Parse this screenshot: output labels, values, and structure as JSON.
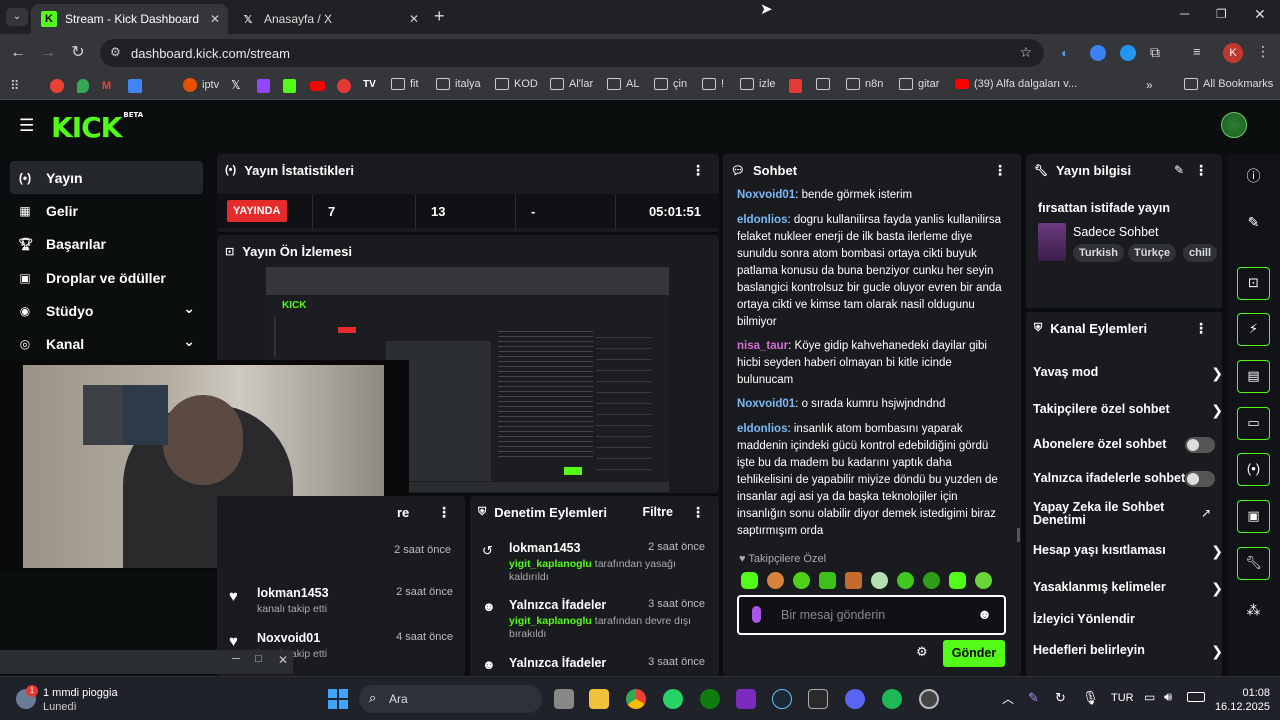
{
  "browser": {
    "tabs": [
      {
        "title": "Stream - Kick Dashboard",
        "active": true
      },
      {
        "title": "Anasayfa / X",
        "active": false
      }
    ],
    "url": "dashboard.kick.com/stream",
    "bookmarks": [
      "iptv",
      "fit",
      "italya",
      "KOD",
      "Al'lar",
      "AL",
      "çin",
      "!",
      "izle",
      "n8n",
      "gitar",
      "(39) Alfa dalgaları v...",
      "All Bookmarks"
    ],
    "profile_letter": "K"
  },
  "kick": {
    "logo": "KICK",
    "logo_badge": "BETA",
    "sidebar": [
      {
        "label": "Yayın",
        "icon": "broadcast-icon",
        "active": true
      },
      {
        "label": "Gelir",
        "icon": "revenue-icon"
      },
      {
        "label": "Başarılar",
        "icon": "trophy-icon"
      },
      {
        "label": "Droplar ve ödüller",
        "icon": "gift-icon"
      },
      {
        "label": "Stüdyo",
        "icon": "studio-icon",
        "chev": "⌄"
      },
      {
        "label": "Kanal",
        "icon": "channel-icon",
        "chev": "⌄"
      }
    ],
    "stats": {
      "title": "Yayın İstatistikleri",
      "live_badge": "YAYINDA",
      "viewers": "7",
      "followers": "13",
      "dash": "-",
      "uptime": "05:01:51"
    },
    "preview": {
      "title": "Yayın Ön İzlemesi"
    },
    "activity": {
      "title": "re",
      "items": [
        {
          "time": "2 saat önce"
        },
        {
          "user": "lokman1453",
          "text": "kanalı takip etti",
          "time": "2 saat önce"
        },
        {
          "user": "Noxvoid01",
          "text": "kanalı takip etti",
          "time": "4 saat önce"
        }
      ]
    },
    "moderation": {
      "title": "Denetim Eylemleri",
      "filter": "Filtre",
      "items": [
        {
          "title": "lokman1453",
          "mod": "yigit_kaplanoglu",
          "text": "tarafından yasağı kaldırıldı",
          "time": "2 saat önce"
        },
        {
          "title": "Yalnızca İfadeler",
          "mod": "yigit_kaplanoglu",
          "text": "tarafından devre dışı bırakıldı",
          "time": "3 saat önce"
        },
        {
          "title": "Yalnızca İfadeler",
          "time": "3 saat önce"
        }
      ]
    },
    "chat": {
      "title": "Sohbet",
      "messages": [
        {
          "user": "Noxvoid01",
          "text": "bende görmek isterim"
        },
        {
          "user": "eldonlios",
          "text": "dogru kullanilirsa fayda yanlis kullanilirsa felaket nukleer enerji de ilk basta ilerleme diye sunuldu sonra atom bombasi ortaya cikti buyuk patlama konusu da buna benziyor cunku her seyin baslangici kontrolsuz bir gucle oluyor evren bir anda ortaya cikti ve kimse tam olarak nasil oldugunu bilmiyor"
        },
        {
          "user": "nisa_taur",
          "text": "Köye gidip kahvehanedeki dayilar gibi hicbi seyden haberi olmayan bi kitle icinde bulunucam"
        },
        {
          "user": "Noxvoid01",
          "text": "o sırada kumru hsjwjndndnd"
        },
        {
          "user": "eldonlios",
          "text": "insanlık atom bombasını yaparak maddenin içindeki gücü kontrol edebildiğini gördü işte bu da madem bu kadarını yaptık daha tehlikelisini de yapabilir miyize döndü bu yuzden de insanlar agi asi ya da başka teknolojiler için insanlığın sonu olabilir diyor demek istedigimi biraz saptırmışım orda"
        }
      ],
      "follower_only": "Takipçilere Özel",
      "input_placeholder": "Bir mesaj gönderin",
      "send": "Gönder"
    },
    "stream_info": {
      "title": "Yayın bilgisi",
      "stream_title": "fırsattan istifade yayın",
      "category": "Sadece Sohbet",
      "tags": [
        "Turkish",
        "Türkçe",
        "chill"
      ]
    },
    "channel_actions": {
      "title": "Kanal Eylemleri",
      "items": [
        {
          "label": "Yavaş mod",
          "type": "arrow"
        },
        {
          "label": "Takipçilere özel sohbet",
          "type": "arrow"
        },
        {
          "label": "Abonelere özel sohbet",
          "type": "toggle"
        },
        {
          "label": "Yalnızca ifadelerle sohbet",
          "type": "toggle"
        },
        {
          "label": "Yapay Zeka ile Sohbet Denetimi",
          "type": "external"
        },
        {
          "label": "Hesap yaşı kısıtlaması",
          "type": "arrow"
        },
        {
          "label": "Yasaklanmış kelimeler",
          "type": "arrow"
        },
        {
          "label": "İzleyici Yönlendir",
          "type": "none"
        },
        {
          "label": "Hedefleri belirleyin",
          "type": "arrow"
        }
      ]
    }
  },
  "taskbar": {
    "weather_line1": "1 mmdi pioggia",
    "weather_line2": "Lunedì",
    "search": "Ara",
    "lang": "TUR",
    "time": "01:08",
    "date": "16.12.2025"
  },
  "colors": {
    "kick_green": "#53fc18",
    "live_red": "#e62b2b",
    "panel": "#191b1f"
  }
}
